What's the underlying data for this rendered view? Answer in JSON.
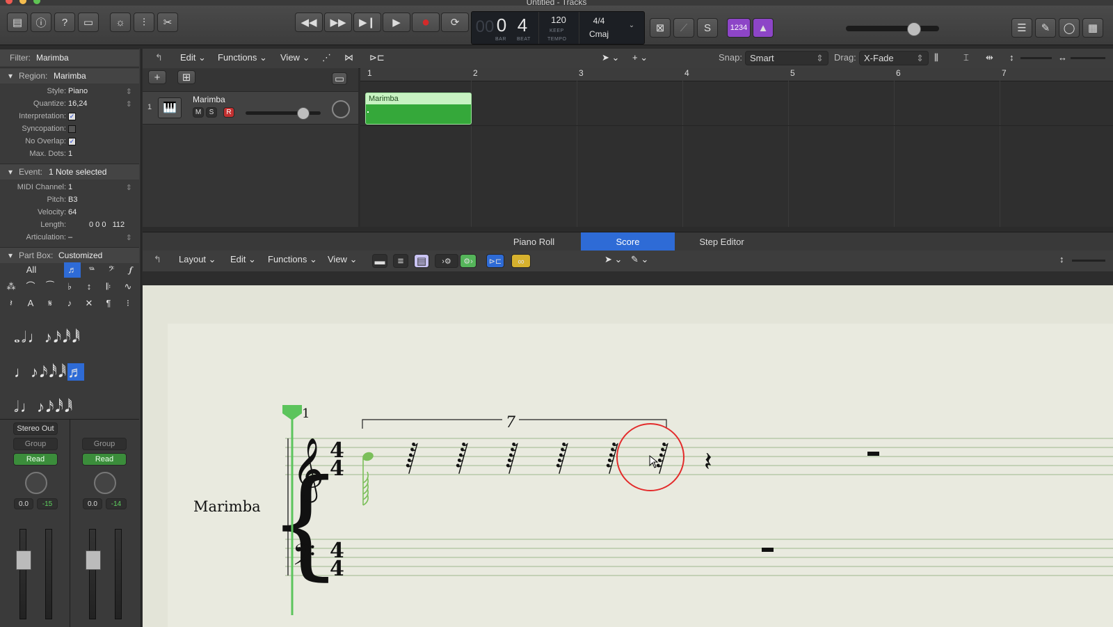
{
  "window": {
    "title": "Untitled - Tracks"
  },
  "control_bar": {
    "buttons": [
      "library",
      "inspector",
      "quick-help",
      "toolbar",
      "smart-controls",
      "mixer",
      "editors"
    ],
    "transport": [
      "rewind",
      "fast-forward",
      "go-to-start",
      "play",
      "record",
      "cycle"
    ],
    "lcd": {
      "bar": "0",
      "beat": "4",
      "tempo": "120",
      "tempo_label": "KEEP",
      "tempo_sub": "TEMPO",
      "bar_label": "BAR",
      "beat_label": "BEAT",
      "signature": "4/4",
      "key": "Cmaj"
    },
    "count_in": "1234",
    "right_buttons": [
      "list-editors",
      "note-pad",
      "loop-browser",
      "browsers"
    ]
  },
  "inspector": {
    "filter_label": "Filter:",
    "filter_value": "Marimba",
    "region_label": "Region:",
    "region_value": "Marimba",
    "region_fields": [
      {
        "label": "Style:",
        "value": "Piano"
      },
      {
        "label": "Quantize:",
        "value": "16,24"
      },
      {
        "label": "Interpretation:",
        "checked": true
      },
      {
        "label": "Syncopation:",
        "checked": false
      },
      {
        "label": "No Overlap:",
        "checked": true
      },
      {
        "label": "Max. Dots:",
        "value": "1"
      }
    ],
    "event_label": "Event:",
    "event_value": "1 Note selected",
    "event_fields": [
      {
        "label": "MIDI Channel:",
        "value": "1"
      },
      {
        "label": "Pitch:",
        "value": "B3"
      },
      {
        "label": "Velocity:",
        "value": "64"
      },
      {
        "label": "Length:",
        "value": "0 0 0   112"
      },
      {
        "label": "Articulation:",
        "value": "–"
      }
    ],
    "partbox_label": "Part Box:",
    "partbox_value": "Customized",
    "partbox_all": "All",
    "strips": [
      {
        "output": "Stereo Out",
        "group": "Group",
        "automation": "Read",
        "volume": "0.0",
        "peak": "-15"
      },
      {
        "output": "",
        "group": "Group",
        "automation": "Read",
        "volume": "0.0",
        "peak": "-14"
      }
    ]
  },
  "tracks": {
    "menus": [
      "Edit",
      "Functions",
      "View"
    ],
    "snap_label": "Snap:",
    "snap_value": "Smart",
    "drag_label": "Drag:",
    "drag_value": "X-Fade",
    "track": {
      "number": "1",
      "name": "Marimba",
      "mute": "M",
      "solo": "S",
      "record": "R",
      "volume": 0.8
    },
    "ruler_bars": [
      "1",
      "2",
      "3",
      "4",
      "5",
      "6",
      "7"
    ],
    "region": {
      "name": "Marimba"
    }
  },
  "editor": {
    "tabs": [
      "Piano Roll",
      "Score",
      "Step Editor"
    ],
    "active_tab": "Score",
    "menus": [
      "Layout",
      "Edit",
      "Functions",
      "View"
    ],
    "score": {
      "instrument": "Marimba",
      "bar_number": "1",
      "tuplet": "7",
      "time_signature": [
        "4",
        "4"
      ]
    }
  },
  "colors": {
    "accent": "#2e6bd6",
    "region_green": "#35a83a",
    "record_red": "#d42a2a",
    "note_green": "#7bbf5a",
    "annotation_red": "#e32b2b"
  }
}
